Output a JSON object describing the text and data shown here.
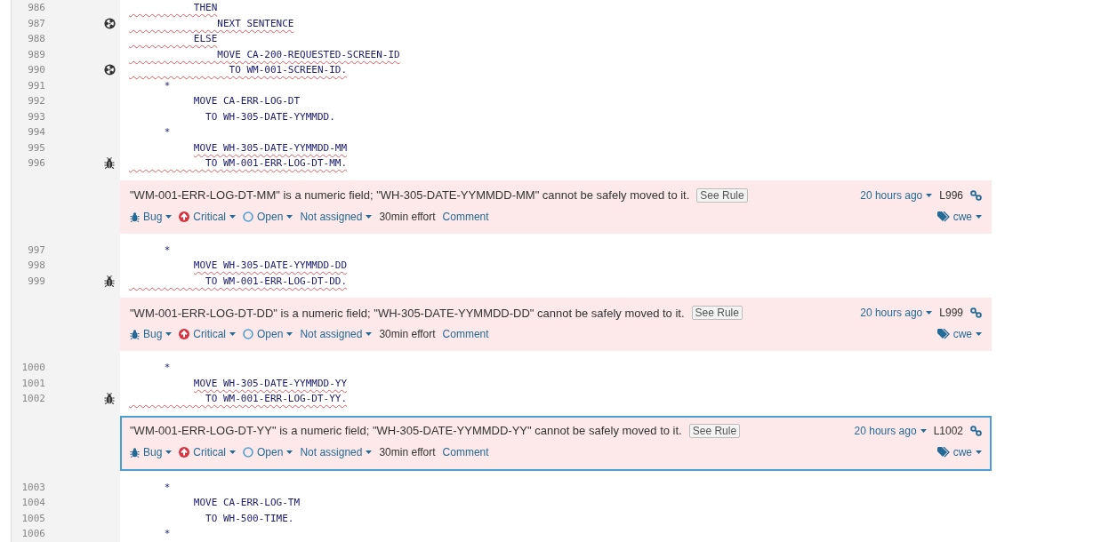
{
  "rows": [
    {
      "kind": "line",
      "number": "986",
      "hotspot": false,
      "bug": false,
      "code": "           THEN",
      "underlined": true,
      "underline_indent": true
    },
    {
      "kind": "line",
      "number": "987",
      "hotspot": true,
      "bug": false,
      "code": "               NEXT SENTENCE",
      "underlined": true,
      "underline_indent": true
    },
    {
      "kind": "line",
      "number": "988",
      "hotspot": false,
      "bug": false,
      "code": "           ELSE",
      "underlined": true,
      "underline_indent": true
    },
    {
      "kind": "line",
      "number": "989",
      "hotspot": false,
      "bug": false,
      "code": "               MOVE CA-200-REQUESTED-SCREEN-ID",
      "underlined": true,
      "underline_indent": true
    },
    {
      "kind": "line",
      "number": "990",
      "hotspot": true,
      "bug": false,
      "code": "                 TO WM-001-SCREEN-ID.",
      "underlined": true,
      "underline_indent": true
    },
    {
      "kind": "line",
      "number": "991",
      "hotspot": false,
      "bug": false,
      "code": "      *",
      "underlined": false
    },
    {
      "kind": "line",
      "number": "992",
      "hotspot": false,
      "bug": false,
      "code": "           MOVE CA-ERR-LOG-DT",
      "underlined": false
    },
    {
      "kind": "line",
      "number": "993",
      "hotspot": false,
      "bug": false,
      "code": "             TO WH-305-DATE-YYMMDD.",
      "underlined": false
    },
    {
      "kind": "line",
      "number": "994",
      "hotspot": false,
      "bug": false,
      "code": "      *",
      "underlined": false
    },
    {
      "kind": "line",
      "number": "995",
      "hotspot": false,
      "bug": false,
      "code": "           MOVE WH-305-DATE-YYMMDD-MM",
      "underlined": true,
      "underline_indent": false
    },
    {
      "kind": "line",
      "number": "996",
      "hotspot": false,
      "bug": true,
      "code": "             TO WM-001-ERR-LOG-DT-MM.",
      "underlined": true,
      "underline_indent": true
    },
    {
      "kind": "issue",
      "selected": false,
      "message": "\"WM-001-ERR-LOG-DT-MM\" is a numeric field; \"WH-305-DATE-YYMMDD-MM\" cannot be safely moved to it.",
      "rule_link": "See Rule",
      "age": "20 hours ago",
      "line_ref": "L996",
      "type": "Bug",
      "severity": "Critical",
      "status": "Open",
      "assignee": "Not assigned",
      "effort": "30min effort",
      "comment": "Comment",
      "tag": "cwe"
    },
    {
      "kind": "line",
      "number": "997",
      "hotspot": false,
      "bug": false,
      "code": "      *",
      "underlined": false
    },
    {
      "kind": "line",
      "number": "998",
      "hotspot": false,
      "bug": false,
      "code": "           MOVE WH-305-DATE-YYMMDD-DD",
      "underlined": true,
      "underline_indent": false
    },
    {
      "kind": "line",
      "number": "999",
      "hotspot": false,
      "bug": true,
      "code": "             TO WM-001-ERR-LOG-DT-DD.",
      "underlined": true,
      "underline_indent": true
    },
    {
      "kind": "issue",
      "selected": false,
      "message": "\"WM-001-ERR-LOG-DT-DD\" is a numeric field; \"WH-305-DATE-YYMMDD-DD\" cannot be safely moved to it.",
      "rule_link": "See Rule",
      "age": "20 hours ago",
      "line_ref": "L999",
      "type": "Bug",
      "severity": "Critical",
      "status": "Open",
      "assignee": "Not assigned",
      "effort": "30min effort",
      "comment": "Comment",
      "tag": "cwe"
    },
    {
      "kind": "line",
      "number": "1000",
      "hotspot": false,
      "bug": false,
      "code": "      *",
      "underlined": false
    },
    {
      "kind": "line",
      "number": "1001",
      "hotspot": false,
      "bug": false,
      "code": "           MOVE WH-305-DATE-YYMMDD-YY",
      "underlined": true,
      "underline_indent": false
    },
    {
      "kind": "line",
      "number": "1002",
      "hotspot": false,
      "bug": true,
      "code": "             TO WM-001-ERR-LOG-DT-YY.",
      "underlined": true,
      "underline_indent": true
    },
    {
      "kind": "issue",
      "selected": true,
      "message": "\"WM-001-ERR-LOG-DT-YY\" is a numeric field; \"WH-305-DATE-YYMMDD-YY\" cannot be safely moved to it.",
      "rule_link": "See Rule",
      "age": "20 hours ago",
      "line_ref": "L1002",
      "type": "Bug",
      "severity": "Critical",
      "status": "Open",
      "assignee": "Not assigned",
      "effort": "30min effort",
      "comment": "Comment",
      "tag": "cwe"
    },
    {
      "kind": "line",
      "number": "1003",
      "hotspot": false,
      "bug": false,
      "code": "      *",
      "underlined": false
    },
    {
      "kind": "line",
      "number": "1004",
      "hotspot": false,
      "bug": false,
      "code": "           MOVE CA-ERR-LOG-TM",
      "underlined": false
    },
    {
      "kind": "line",
      "number": "1005",
      "hotspot": false,
      "bug": false,
      "code": "             TO WH-500-TIME.",
      "underlined": false
    },
    {
      "kind": "line",
      "number": "1006",
      "hotspot": false,
      "bug": false,
      "code": "      *",
      "underlined": false
    }
  ]
}
